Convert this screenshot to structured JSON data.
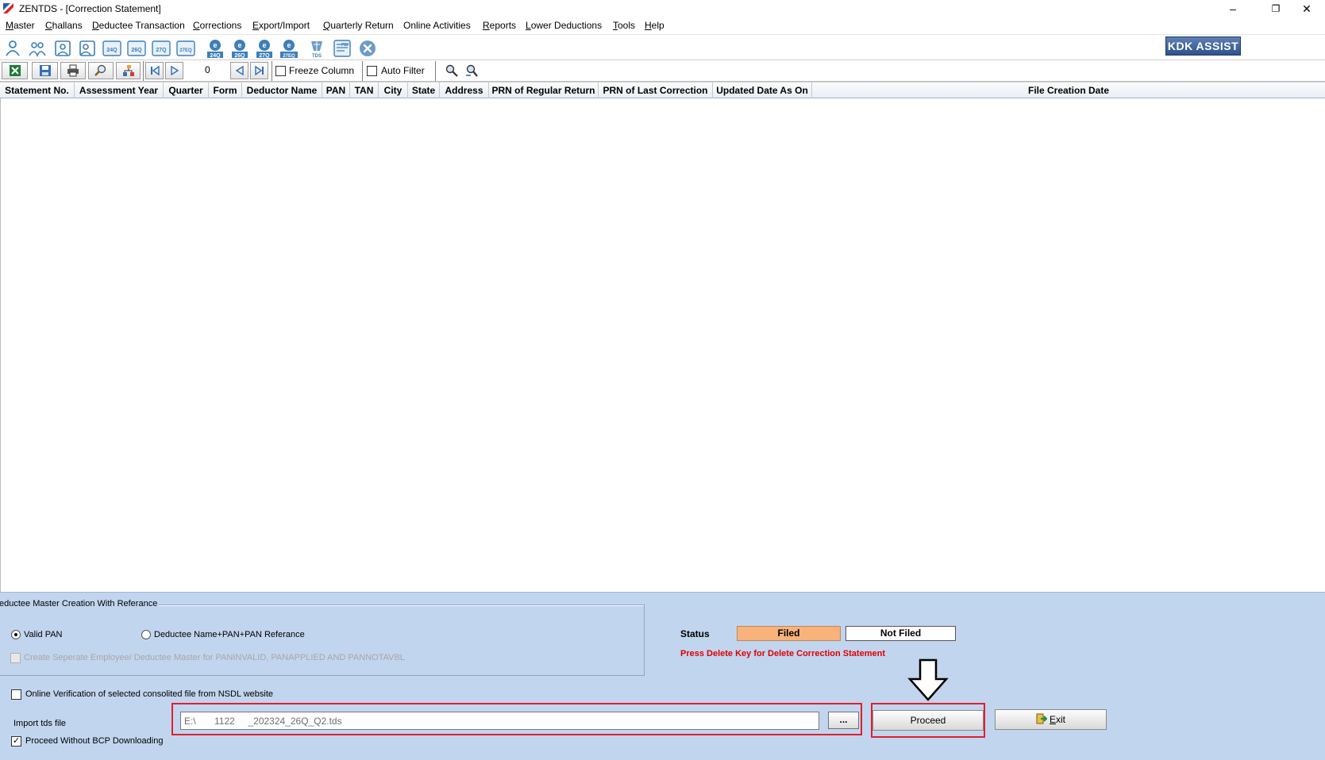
{
  "window": {
    "title": "ZENTDS - [Correction Statement]",
    "minimize": "–",
    "restore": "❐",
    "close": "✕"
  },
  "menu": [
    {
      "label": "Master",
      "underline": "M",
      "rest": "aster"
    },
    {
      "label": "Challans",
      "underline": "C",
      "rest": "hallans"
    },
    {
      "label": "Deductee Transaction",
      "underline": "D",
      "rest": "eductee Transaction"
    },
    {
      "label": "Corrections",
      "underline": "C",
      "rest": "orrections"
    },
    {
      "label": "Export/Import",
      "underline": "E",
      "rest": "xport/Import"
    },
    {
      "label": "Quarterly Return",
      "underline": "Q",
      "rest": "uarterly Return"
    },
    {
      "label": "Online Activities",
      "underline": "",
      "rest": "Online Activities"
    },
    {
      "label": "Reports",
      "underline": "R",
      "rest": "eports"
    },
    {
      "label": "Lower Deductions",
      "underline": "L",
      "rest": "ower Deductions"
    },
    {
      "label": "Tools",
      "underline": "T",
      "rest": "ools"
    },
    {
      "label": "Help",
      "underline": "H",
      "rest": "elp"
    }
  ],
  "toolbar": {
    "icons": [
      "deductor-icon",
      "deductees-icon",
      "employee-icon",
      "employee-2-icon",
      "form-24q-icon",
      "form-26q-icon",
      "form-27q-icon",
      "form-27eq-icon",
      "e-24q-icon",
      "e-26q-icon",
      "e-27q-icon",
      "e-27eq-icon",
      "tds-icon",
      "pdf-icon",
      "close-circle-icon"
    ],
    "icon_texts": [
      "",
      "",
      "",
      "",
      "24Q",
      "26Q",
      "27Q",
      "27EQ",
      "24Q",
      "26Q",
      "27Q",
      "27EQ",
      "TDS",
      "PDF",
      ""
    ],
    "kdk_assist": "KDK ASSIST"
  },
  "navbar": {
    "record_count": "0",
    "freeze_column": "Freeze Column",
    "auto_filter": "Auto Filter"
  },
  "grid": {
    "columns": [
      "Statement No.",
      "Assessment Year",
      "Quarter",
      "Form",
      "Deductor Name",
      "PAN",
      "TAN",
      "City",
      "State",
      "Address",
      "PRN of Regular Return",
      "PRN of Last Correction",
      "Updated Date As On",
      "File Creation Date"
    ],
    "rows": []
  },
  "bottom": {
    "ref_group_title": "eductee Master Creation With Referance",
    "radio_valid_pan": "Valid PAN",
    "radio_name_pan": "Deductee Name+PAN+PAN Referance",
    "create_separate": "Create Seperate Employee/ Deductee Master for PANINVALID, PANAPPLIED AND PANNOTAVBL",
    "status_label": "Status",
    "filed": "Filed",
    "not_filed": "Not Filed",
    "delete_hint": "Press Delete Key for Delete Correction Statement",
    "online_verification": "Online Verification of selected consolited file from NSDL website",
    "import_label": "Import tds file",
    "import_value": "E:\\       1122     _202324_26Q_Q2.tds",
    "browse": "...",
    "proceed_without_bcp": "Proceed Without BCP Downloading",
    "proceed": "Proceed",
    "exit_e": "E",
    "exit_rest": "xit"
  },
  "colors": {
    "panel_bg": "#c2d5ee",
    "filed": "#f8b27a",
    "highlight": "#e01f2e",
    "hint": "#e00000"
  }
}
